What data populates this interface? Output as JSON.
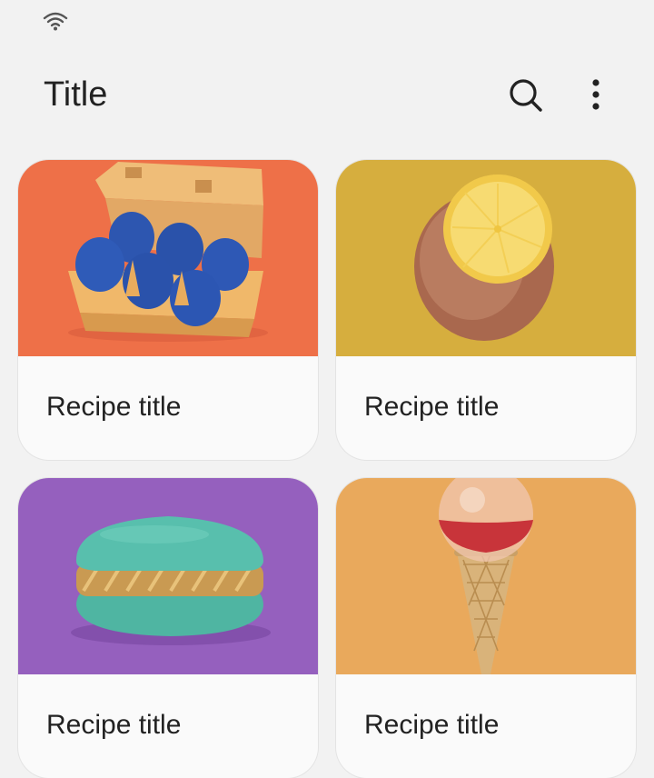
{
  "status_bar": {
    "wifi_icon": "wifi-icon"
  },
  "app_bar": {
    "title": "Title",
    "search_icon": "search-icon",
    "more_icon": "more-vertical-icon"
  },
  "recipes": [
    {
      "title": "Recipe title",
      "image": "blue eggs in carton",
      "bg": "#ee7048"
    },
    {
      "title": "Recipe title",
      "image": "copper lemon half",
      "bg": "#d6ae3e"
    },
    {
      "title": "Recipe title",
      "image": "teal macaron",
      "bg": "#9560be"
    },
    {
      "title": "Recipe title",
      "image": "ice cream cone with glass ball",
      "bg": "#e9a95c"
    }
  ]
}
